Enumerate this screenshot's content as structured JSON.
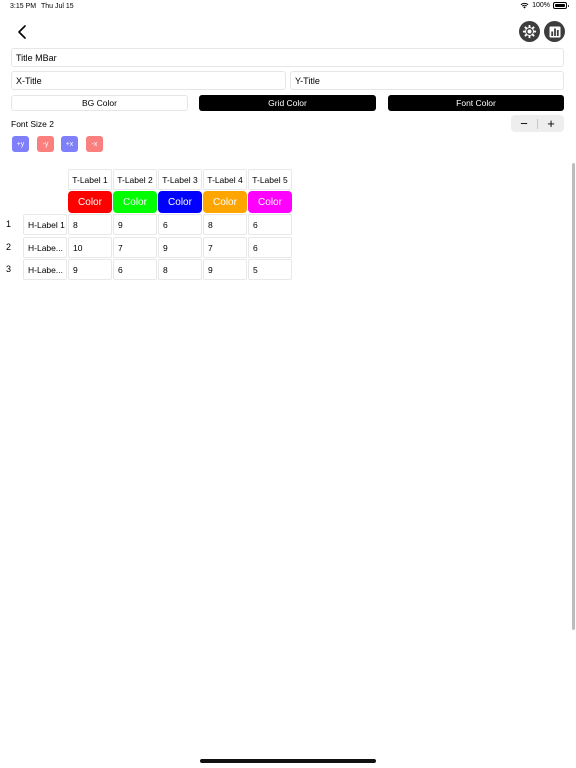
{
  "status": {
    "time": "3:15 PM",
    "date": "Thu Jul 15",
    "battery": "100%"
  },
  "inputs": {
    "title": "Title MBar",
    "x_title": "X-Title",
    "y_title": "Y-Title"
  },
  "color_buttons": {
    "bg": "BG Color",
    "grid": "Grid Color",
    "font": "Font Color"
  },
  "font_size": {
    "label": "Font Size 2",
    "minus": "−",
    "plus": "+"
  },
  "axis_buttons": {
    "add_y": "+y",
    "remove_y": "-y",
    "add_x": "+x",
    "remove_x": "-x"
  },
  "colors": {
    "add": "#7f7ffa",
    "remove": "#fa7f7f",
    "series": [
      "#ff0000",
      "#00ff00",
      "#0000ff",
      "#ffa500",
      "#ff00ff"
    ]
  },
  "grid": {
    "columns": [
      "T-Label 1",
      "T-Label 2",
      "T-Label 3",
      "T-Label 4",
      "T-Label 5"
    ],
    "color_label": "Color",
    "rows": [
      {
        "num": "1",
        "label": "H-Label 1",
        "values": [
          "8",
          "9",
          "6",
          "8",
          "6"
        ]
      },
      {
        "num": "2",
        "label": "H-Labe...",
        "values": [
          "10",
          "7",
          "9",
          "7",
          "6"
        ]
      },
      {
        "num": "3",
        "label": "H-Labe...",
        "values": [
          "9",
          "6",
          "8",
          "9",
          "5"
        ]
      }
    ]
  }
}
